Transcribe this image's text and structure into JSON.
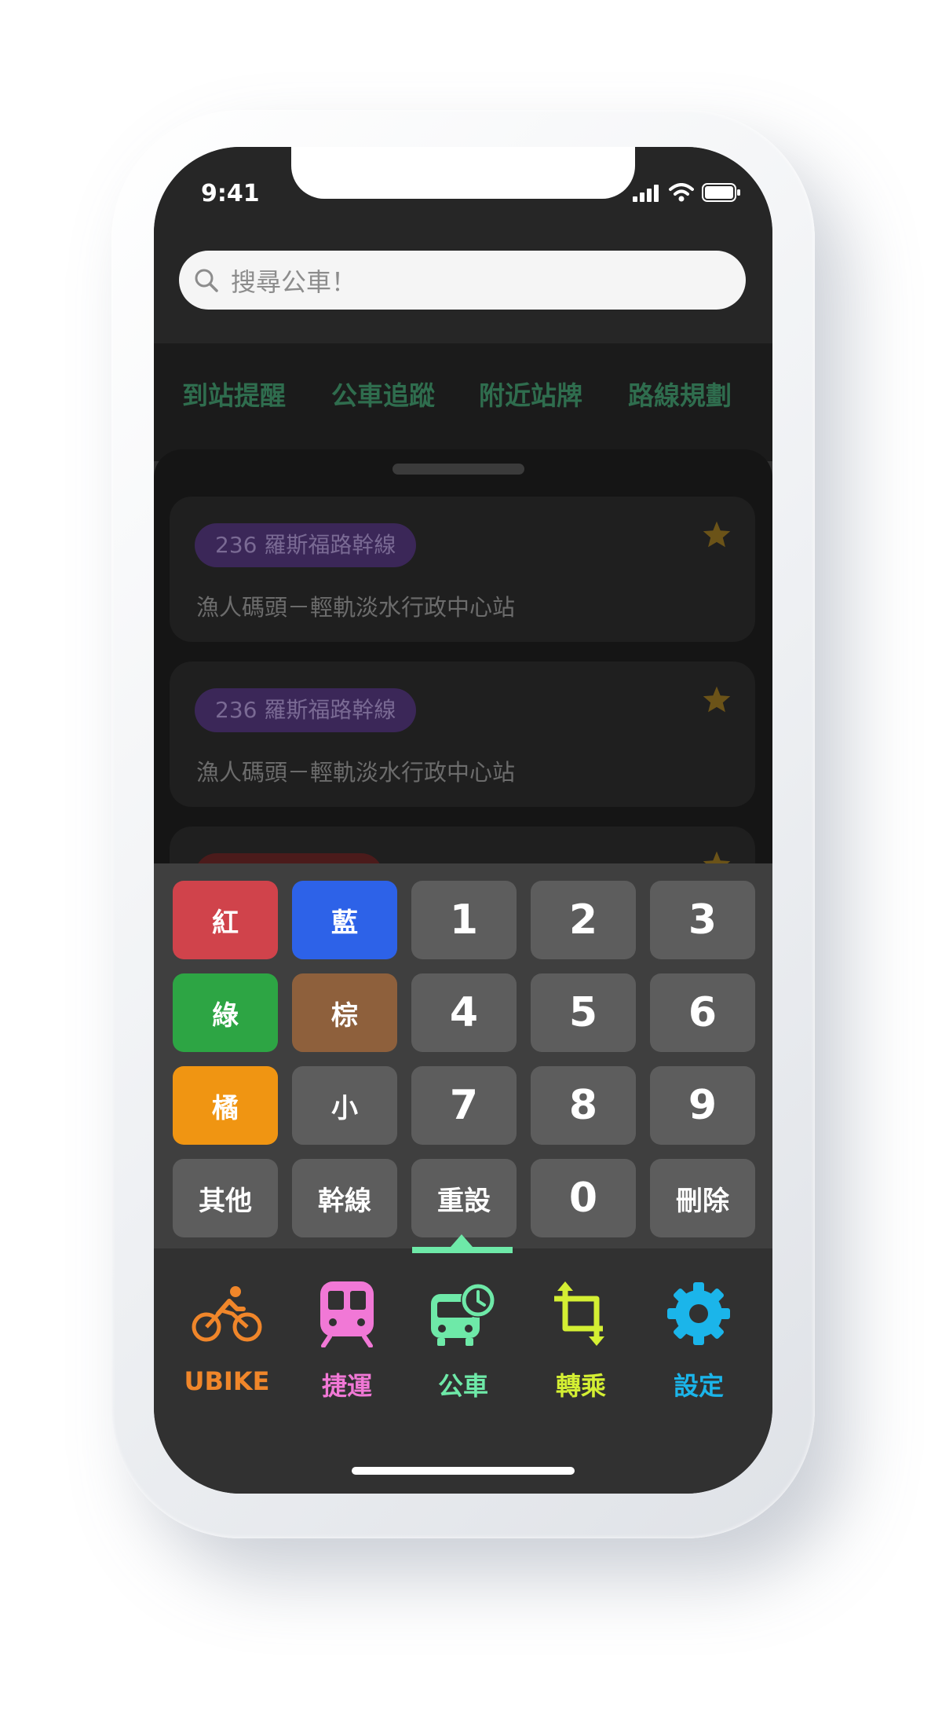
{
  "status": {
    "time": "9:41"
  },
  "search": {
    "placeholder": "搜尋公車！"
  },
  "quick_tabs": [
    "到站提醒",
    "公車追蹤",
    "附近站牌",
    "路線規劃"
  ],
  "cards": [
    {
      "route": "236 羅斯福路幹線",
      "desc": "漁人碼頭－輕軌淡水行政中心站",
      "favorite": true
    },
    {
      "route": "236 羅斯福路幹線",
      "desc": "漁人碼頭－輕軌淡水行政中心站",
      "favorite": true
    }
  ],
  "keypad": {
    "keys": [
      [
        "紅",
        "藍",
        "1",
        "2",
        "3"
      ],
      [
        "綠",
        "棕",
        "4",
        "5",
        "6"
      ],
      [
        "橘",
        "小",
        "7",
        "8",
        "9"
      ],
      [
        "其他",
        "幹線",
        "重設",
        "0",
        "刪除"
      ]
    ],
    "colors": {
      "red": "#d0434b",
      "blue": "#2d62e8",
      "green": "#2da544",
      "brown": "#8e603c",
      "orange": "#f09512",
      "gray": "#5d5d5d"
    }
  },
  "tabbar": {
    "selected": "bus",
    "items": [
      {
        "id": "ubike",
        "label": "UBIKE",
        "icon": "bicycle-icon",
        "color": "#f0862a"
      },
      {
        "id": "mrt",
        "label": "捷運",
        "icon": "train-icon",
        "color": "#f178d6"
      },
      {
        "id": "bus",
        "label": "公車",
        "icon": "bus-clock-icon",
        "color": "#6ee9a8"
      },
      {
        "id": "transfer",
        "label": "轉乘",
        "icon": "crop-transfer-icon",
        "color": "#d4ef33"
      },
      {
        "id": "settings",
        "label": "設定",
        "icon": "gear-icon",
        "color": "#1bb5ea"
      }
    ]
  }
}
